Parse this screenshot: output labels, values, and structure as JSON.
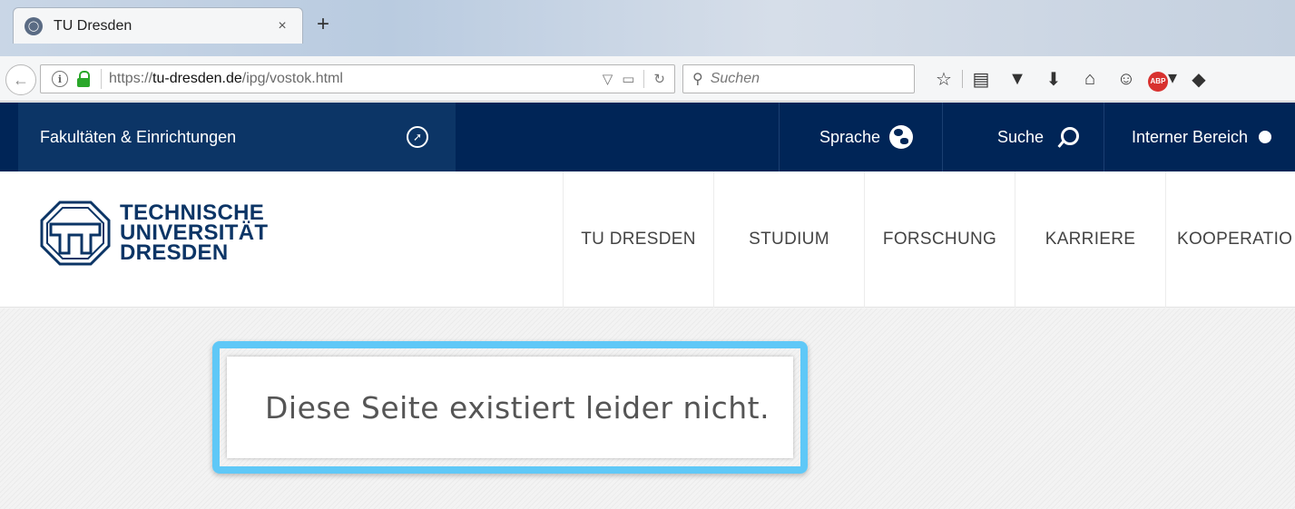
{
  "browser": {
    "tab_title": "TU Dresden",
    "tab_close": "×",
    "new_tab": "+",
    "url_prefix": "https://",
    "url_domain": "tu-dresden.de",
    "url_path": "/ipg/vostok.html",
    "search_placeholder": "Suchen",
    "abp_label": "ABP"
  },
  "topnav": {
    "faculties": "Fakultäten & Einrichtungen",
    "language": "Sprache",
    "search": "Suche",
    "internal": "Interner Bereich"
  },
  "logo": {
    "line1": "TECHNISCHE",
    "line2": "UNIVERSITÄT",
    "line3": "DRESDEN"
  },
  "mainnav": {
    "items": [
      "TU DRESDEN",
      "STUDIUM",
      "FORSCHUNG",
      "KARRIERE",
      "KOOPERATIO"
    ]
  },
  "content": {
    "message": "Diese Seite existiert leider nicht."
  },
  "colors": {
    "navy": "#002557",
    "highlight": "#5fc8f7"
  }
}
